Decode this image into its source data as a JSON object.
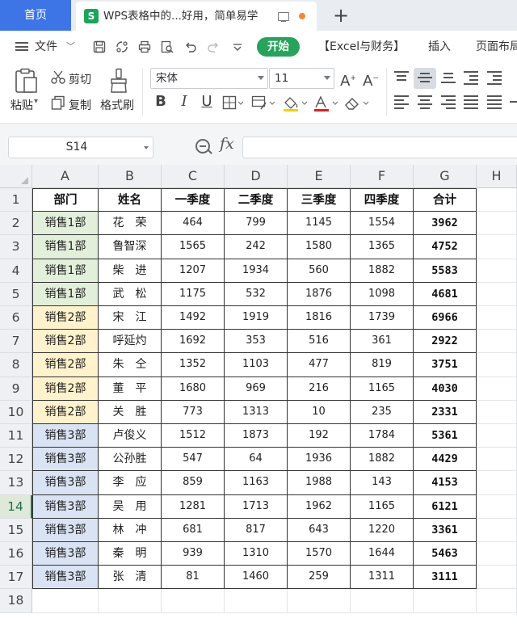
{
  "tabs": {
    "home": "首页",
    "doc_title": "WPS表格中的...好用，简单易学",
    "doc_logo": "S",
    "new_tab": "+"
  },
  "menu": {
    "file": "文件",
    "start": "开始",
    "excel_finance": "【Excel与财务】",
    "insert": "插入",
    "layout": "页面布局"
  },
  "ribbon": {
    "paste": "粘贴",
    "cut": "剪切",
    "copy": "复制",
    "format_painter": "格式刷",
    "font_name": "宋体",
    "font_size": "11",
    "bold": "B",
    "italic": "I",
    "underline": "U"
  },
  "formula_bar": {
    "name_box": "S14",
    "fx": "fx",
    "formula": ""
  },
  "colors": {
    "accent_blue": "#3d74e6",
    "start_green": "#27a35c",
    "dept1_fill": "#e2efda",
    "dept2_fill": "#fff2cc",
    "dept3_fill": "#dae3f3"
  },
  "sheet": {
    "columns": [
      "A",
      "B",
      "C",
      "D",
      "E",
      "F",
      "G",
      "H"
    ],
    "active_row": 14,
    "headers": [
      "部门",
      "姓名",
      "一季度",
      "二季度",
      "三季度",
      "四季度",
      "合计"
    ],
    "rows": [
      [
        "销售1部",
        "花　荣",
        "464",
        "799",
        "1145",
        "1554",
        "3962"
      ],
      [
        "销售1部",
        "鲁智深",
        "1565",
        "242",
        "1580",
        "1365",
        "4752"
      ],
      [
        "销售1部",
        "柴　进",
        "1207",
        "1934",
        "560",
        "1882",
        "5583"
      ],
      [
        "销售1部",
        "武　松",
        "1175",
        "532",
        "1876",
        "1098",
        "4681"
      ],
      [
        "销售2部",
        "宋　江",
        "1492",
        "1919",
        "1816",
        "1739",
        "6966"
      ],
      [
        "销售2部",
        "呼延灼",
        "1692",
        "353",
        "516",
        "361",
        "2922"
      ],
      [
        "销售2部",
        "朱　仝",
        "1352",
        "1103",
        "477",
        "819",
        "3751"
      ],
      [
        "销售2部",
        "董　平",
        "1680",
        "969",
        "216",
        "1165",
        "4030"
      ],
      [
        "销售2部",
        "关　胜",
        "773",
        "1313",
        "10",
        "235",
        "2331"
      ],
      [
        "销售3部",
        "卢俊义",
        "1512",
        "1873",
        "192",
        "1784",
        "5361"
      ],
      [
        "销售3部",
        "公孙胜",
        "547",
        "64",
        "1936",
        "1882",
        "4429"
      ],
      [
        "销售3部",
        "李　应",
        "859",
        "1163",
        "1988",
        "143",
        "4153"
      ],
      [
        "销售3部",
        "吴　用",
        "1281",
        "1713",
        "1962",
        "1165",
        "6121"
      ],
      [
        "销售3部",
        "林　冲",
        "681",
        "817",
        "643",
        "1220",
        "3361"
      ],
      [
        "销售3部",
        "秦　明",
        "939",
        "1310",
        "1570",
        "1644",
        "5463"
      ],
      [
        "销售3部",
        "张　清",
        "81",
        "1460",
        "259",
        "1311",
        "3111"
      ]
    ]
  }
}
